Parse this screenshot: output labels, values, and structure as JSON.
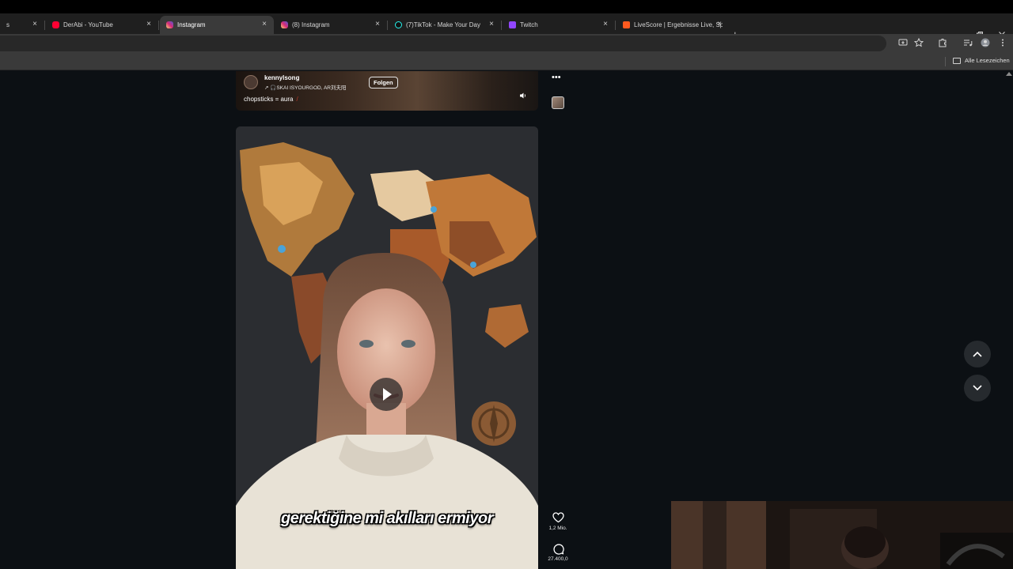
{
  "browser": {
    "tabs": [
      {
        "title": "s",
        "favicon_color": "#1f1f1f",
        "active": false
      },
      {
        "title": "DerAbi - YouTube",
        "favicon_color": "#ff0033",
        "active": false
      },
      {
        "title": "Instagram",
        "favicon_color": "#d62976",
        "active": true
      },
      {
        "title": "(8) Instagram",
        "favicon_color": "#d62976",
        "active": false
      },
      {
        "title": "(7)TikTok - Make Your Day",
        "favicon_color": "#111111",
        "active": false
      },
      {
        "title": "Twitch",
        "favicon_color": "#9146ff",
        "active": false
      },
      {
        "title": "LiveScore | Ergebnisse Live, Sp...",
        "favicon_color": "#ff5a1f",
        "active": false
      }
    ],
    "close_glyph": "×",
    "new_tab_glyph": "+",
    "bookmarks": {
      "all_bookmarks_label": "Alle Lesezeichen"
    }
  },
  "feed": {
    "previous_post": {
      "username": "kennylsong",
      "audio": "↗ 🎧SKAI ISYOURGOD, AR刘夫阳",
      "follow_label": "Folgen",
      "caption": "chopsticks = aura",
      "caption_suffix": "/"
    },
    "current_reel": {
      "subtitle": "gerektiğine mi akılları ermiyor",
      "likes": "1,2 Mio.",
      "comments": "27.400,0"
    },
    "more_glyph": "•••"
  },
  "colors": {
    "page_background": "#0c1014",
    "tab_bar": "#1f1f1f",
    "toolbar": "#3a3a3a",
    "instagram_accent": "#d62976"
  }
}
